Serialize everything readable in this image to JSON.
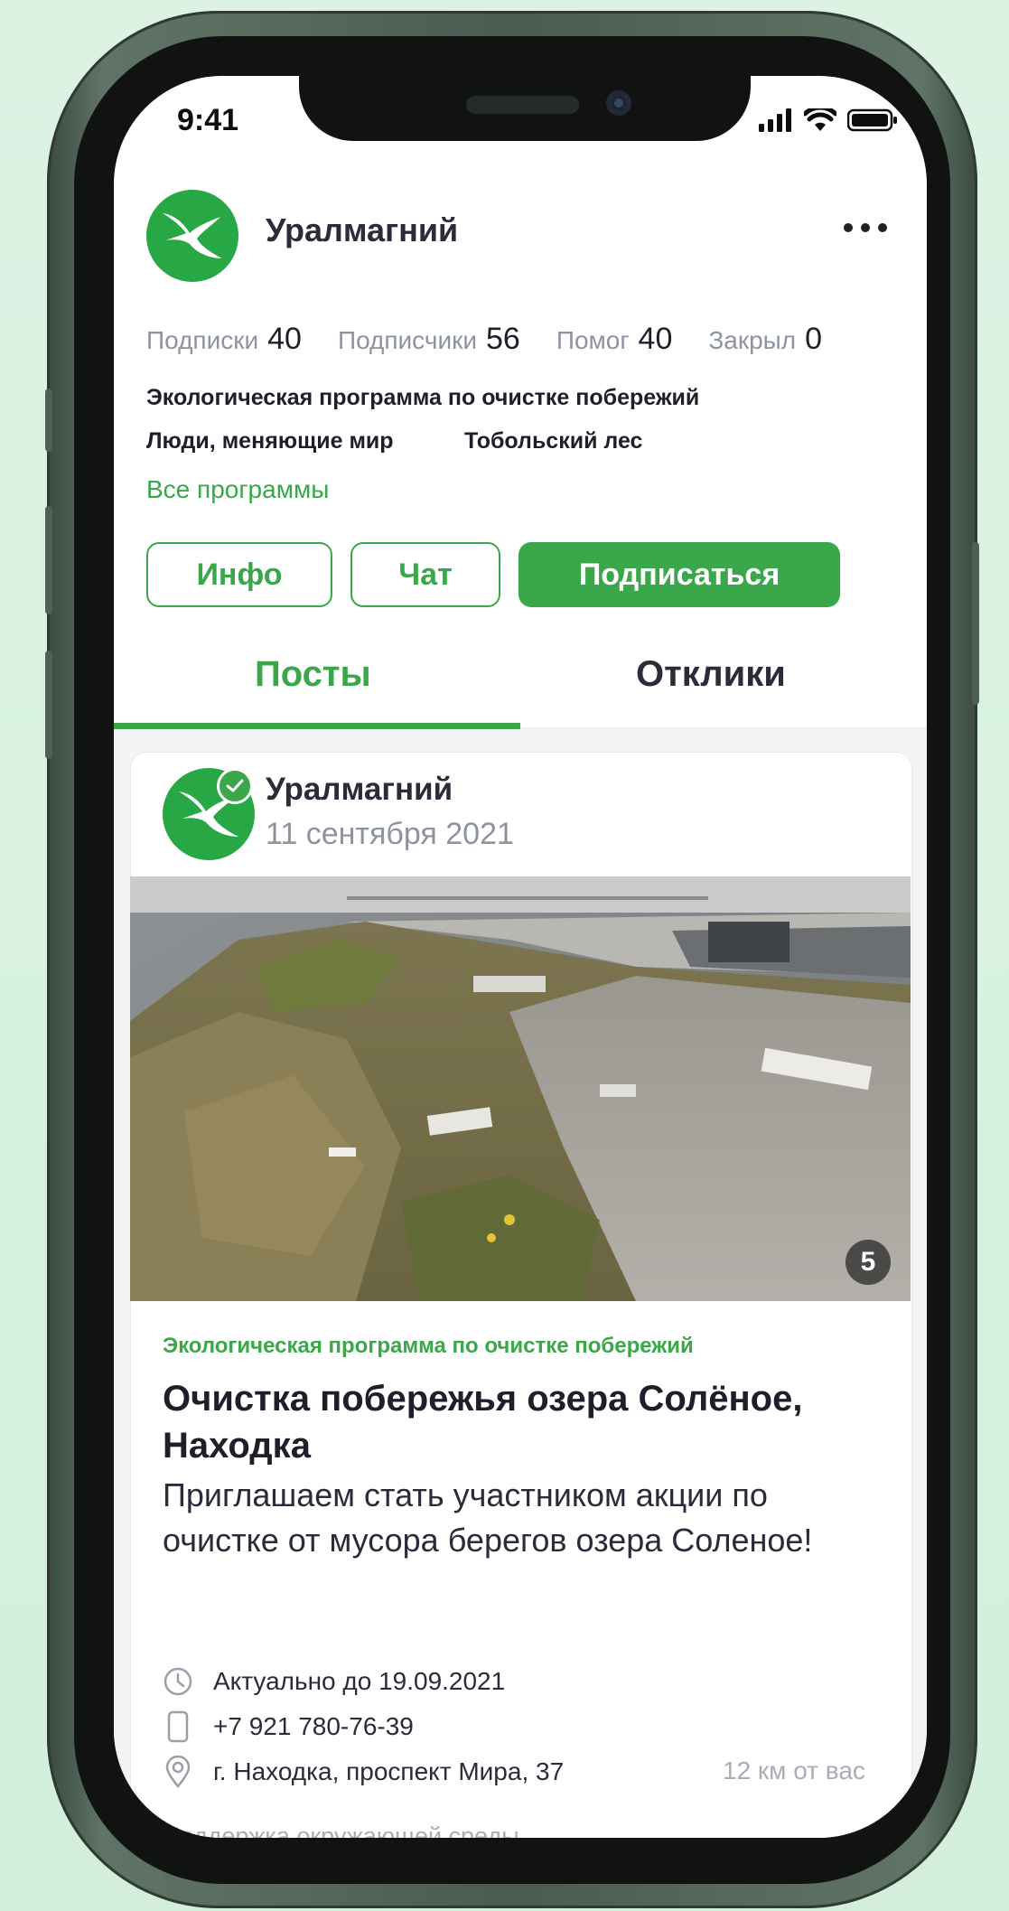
{
  "status_bar": {
    "time": "9:41"
  },
  "profile": {
    "name": "Уралмагний",
    "avatar_icon": "seagull-icon",
    "menu_icon": "more-dots-icon",
    "stats": [
      {
        "label": "Подписки",
        "value": "40"
      },
      {
        "label": "Подписчики",
        "value": "56"
      },
      {
        "label": "Помог",
        "value": "40"
      },
      {
        "label": "Закрыл",
        "value": "0"
      }
    ],
    "programs": [
      "Экологическая программа по очистке побережий",
      "Люди, меняющие мир",
      "Тобольский лес"
    ],
    "all_programs": "Все программы"
  },
  "actions": {
    "info": "Инфо",
    "chat": "Чат",
    "subscribe": "Подписаться"
  },
  "tabs": {
    "posts": "Посты",
    "responses": "Отклики"
  },
  "post": {
    "author": "Уралмагний",
    "date": "11 сентября 2021",
    "photo_count": "5",
    "category": "Экологическая программа по очистке побережий",
    "title": "Очистка побережья озера Солёное, Находка",
    "description": "Приглашаем стать участником акции по очистке от мусора берегов озера Соленое!",
    "deadline": "Актуально до 19.09.2021",
    "phone": "+7 921 780-76-39",
    "address": "г. Находка, проспект Мира, 37",
    "distance": "12 км от вас",
    "tag": "Поддержка окружающей среды"
  },
  "colors": {
    "accent": "#3aa84a",
    "avatar": "#28a745",
    "text": "#1f1f2b",
    "muted": "#8d93a1"
  }
}
